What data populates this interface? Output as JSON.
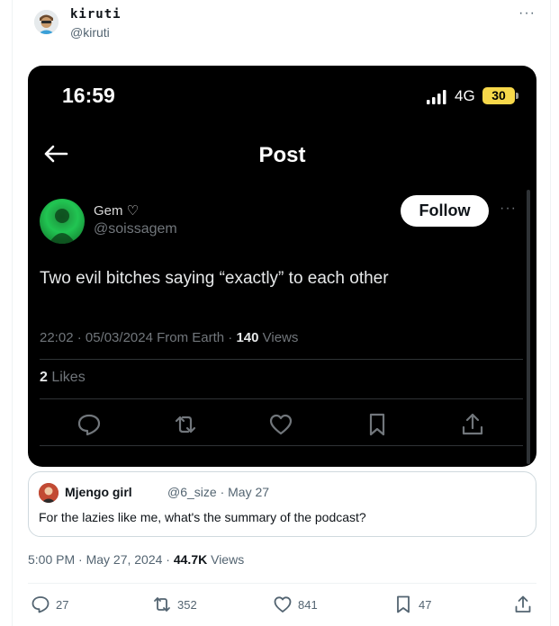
{
  "author": {
    "name": "kiruti",
    "handle": "@kiruti",
    "avatar_icon": "avatar-cartoon-icon"
  },
  "embedded_screenshot": {
    "status_bar": {
      "time": "16:59",
      "network": "4G",
      "battery": "30"
    },
    "nav": {
      "title": "Post"
    },
    "post": {
      "author_name": "Gem ♡",
      "author_handle": "@soissagem",
      "follow_label": "Follow",
      "text": "Two evil bitches saying “exactly” to each other",
      "meta_prefix": "22:02 · 05/03/2024 From Earth · ",
      "views_count": "140",
      "views_label": " Views",
      "likes_count": "2",
      "likes_label": " Likes"
    }
  },
  "quote": {
    "name": "Mjengo girl",
    "meta": "@6_size · May 27",
    "text": "For the lazies like me, what's the summary of the podcast?"
  },
  "tweet_meta": {
    "prefix": "5:00 PM · May 27, 2024 · ",
    "views_count": "44.7K",
    "views_label": " Views"
  },
  "actions": {
    "replies": "27",
    "reposts": "352",
    "likes": "841",
    "bookmarks": "47"
  },
  "colors": {
    "accent": "#1d9bf0",
    "muted": "#536471",
    "dark_bg": "#000000",
    "battery": "#f7d84a",
    "gem_avatar": "#21c552"
  }
}
